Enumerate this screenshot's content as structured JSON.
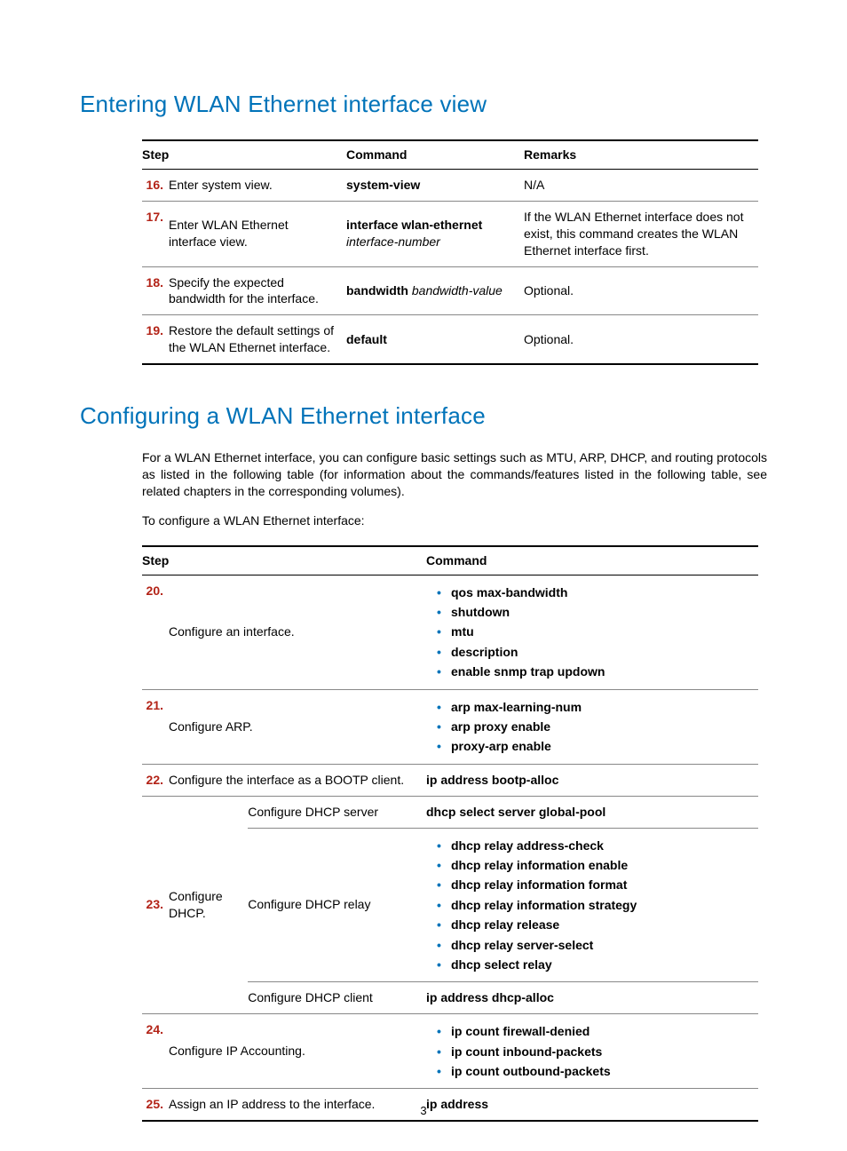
{
  "heading1": "Entering WLAN Ethernet interface view",
  "table1": {
    "headers": {
      "step": "Step",
      "command": "Command",
      "remarks": "Remarks"
    },
    "rows": [
      {
        "num": "16.",
        "desc": "Enter system view.",
        "cmd_bold": "system-view",
        "cmd_ital": "",
        "remarks": "N/A"
      },
      {
        "num": "17.",
        "desc": "Enter WLAN Ethernet interface view.",
        "cmd_bold": "interface wlan-ethernet",
        "cmd_ital": "interface-number",
        "remarks": "If the WLAN Ethernet interface does not exist, this command creates the WLAN Ethernet interface first."
      },
      {
        "num": "18.",
        "desc": "Specify the expected bandwidth for the interface.",
        "cmd_bold": "bandwidth",
        "cmd_ital": " bandwidth-value",
        "remarks": "Optional."
      },
      {
        "num": "19.",
        "desc": "Restore the default settings of the WLAN Ethernet interface.",
        "cmd_bold": "default",
        "cmd_ital": "",
        "remarks": "Optional."
      }
    ]
  },
  "heading2": "Configuring a WLAN Ethernet interface",
  "intro": "For a WLAN Ethernet interface, you can configure basic settings such as MTU, ARP, DHCP, and routing protocols as listed in the following table (for information about the commands/features listed in the following table, see related chapters in the corresponding volumes).",
  "intro2": "To configure a WLAN Ethernet interface:",
  "table2": {
    "headers": {
      "step": "Step",
      "command": "Command"
    },
    "r20": {
      "num": "20.",
      "desc": "Configure an interface.",
      "cmds": [
        "qos max-bandwidth",
        "shutdown",
        "mtu",
        "description",
        "enable snmp trap updown"
      ]
    },
    "r21": {
      "num": "21.",
      "desc": "Configure ARP.",
      "cmds": [
        "arp max-learning-num",
        "arp proxy enable",
        "proxy-arp enable"
      ]
    },
    "r22": {
      "num": "22.",
      "desc": "Configure the interface as a BOOTP client.",
      "cmd": "ip address bootp-alloc"
    },
    "r23": {
      "num": "23.",
      "desc": "Configure DHCP.",
      "sub1": {
        "label": "Configure DHCP server",
        "cmd": "dhcp select server global-pool"
      },
      "sub2": {
        "label": "Configure DHCP relay",
        "cmds": [
          "dhcp relay address-check",
          "dhcp relay information enable",
          "dhcp relay information format",
          "dhcp relay information strategy",
          "dhcp relay release",
          "dhcp relay server-select",
          "dhcp select relay"
        ]
      },
      "sub3": {
        "label": "Configure DHCP client",
        "cmd": "ip address dhcp-alloc"
      }
    },
    "r24": {
      "num": "24.",
      "desc": "Configure IP Accounting.",
      "cmds": [
        "ip count firewall-denied",
        "ip count inbound-packets",
        "ip count outbound-packets"
      ]
    },
    "r25": {
      "num": "25.",
      "desc": "Assign an IP address to the interface.",
      "cmd": "ip address"
    }
  },
  "pagenum": "3"
}
